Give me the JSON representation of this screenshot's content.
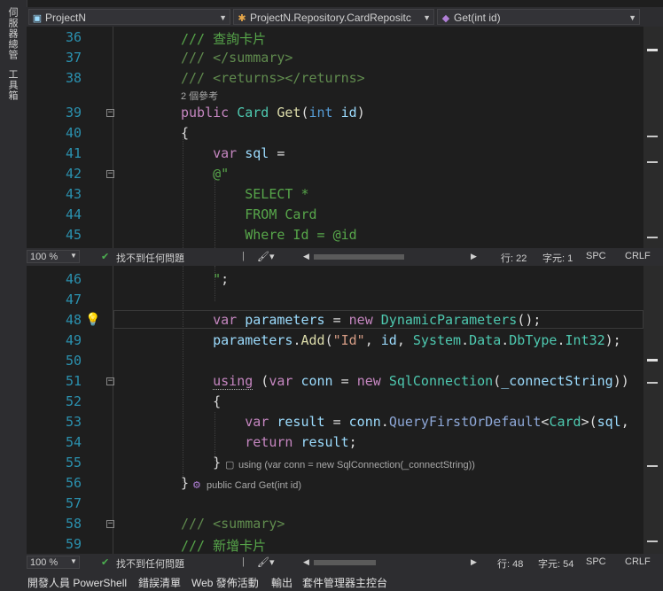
{
  "left_tabs": {
    "server_explorer": "伺服器總管",
    "toolbox": "工具箱"
  },
  "nav": {
    "project": "ProjectN",
    "class": "ProjectN.Repository.CardRepositc",
    "member": "Get(int id)"
  },
  "top_pane": {
    "lines": [
      {
        "n": "36",
        "t": "/// 查詢卡片"
      },
      {
        "n": "37",
        "t": "/// </summary>"
      },
      {
        "n": "38",
        "t": "/// <returns></returns>"
      },
      {
        "n": "39",
        "t": "public Card Get(int id)"
      },
      {
        "n": "40",
        "t": "{"
      },
      {
        "n": "41",
        "t": "var sql ="
      },
      {
        "n": "42",
        "t": "@\""
      },
      {
        "n": "43",
        "t": "SELECT *"
      },
      {
        "n": "44",
        "t": "FROM Card"
      },
      {
        "n": "45",
        "t": "Where Id = @id"
      }
    ],
    "codelens": "2 個參考"
  },
  "top_status": {
    "zoom": "100 %",
    "issues": "找不到任何問題",
    "line": "行: 22",
    "col": "字元: 1",
    "spc": "SPC",
    "crlf": "CRLF"
  },
  "bottom_pane": {
    "lines": [
      {
        "n": "46",
        "t": "\";"
      },
      {
        "n": "47",
        "t": ""
      },
      {
        "n": "48",
        "t": "var parameters = new DynamicParameters();"
      },
      {
        "n": "49",
        "t": "parameters.Add(\"Id\", id, System.Data.DbType.Int32);"
      },
      {
        "n": "50",
        "t": ""
      },
      {
        "n": "51",
        "t": "using (var conn = new SqlConnection(_connectString))"
      },
      {
        "n": "52",
        "t": "{"
      },
      {
        "n": "53",
        "t": "var result = conn.QueryFirstOrDefault<Card>(sql,"
      },
      {
        "n": "54",
        "t": "return result;"
      },
      {
        "n": "55",
        "t": "}"
      },
      {
        "n": "56",
        "t": "}"
      },
      {
        "n": "57",
        "t": ""
      },
      {
        "n": "58",
        "t": "/// <summary>"
      },
      {
        "n": "59",
        "t": "/// 新增卡片"
      }
    ],
    "hint_55": "using (var conn = new SqlConnection(_connectString))",
    "hint_56": "public Card Get(int id)"
  },
  "bottom_status": {
    "zoom": "100 %",
    "issues": "找不到任何問題",
    "line": "行: 48",
    "col": "字元: 54",
    "spc": "SPC",
    "crlf": "CRLF"
  },
  "tool_tabs": [
    "開發人員 PowerShell",
    "錯誤清單",
    "Web 發佈活動",
    "輸出",
    "套件管理器主控台"
  ],
  "colors": {
    "line_number": "#2b91af",
    "comment": "#57a64a",
    "keyword": "#c586c0",
    "keyword_blue": "#569cd6",
    "type": "#4ec9b0",
    "string": "#d69d85",
    "method": "#dcdcaa",
    "variable": "#9cdcfe"
  }
}
